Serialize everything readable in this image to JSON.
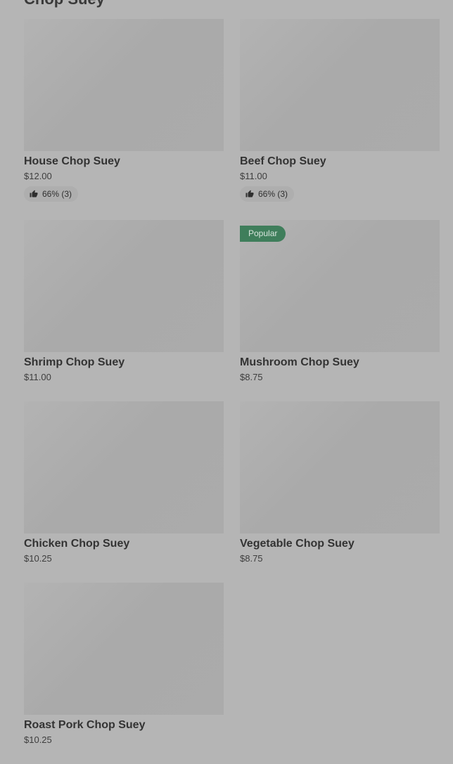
{
  "section": {
    "title": "Chop Suey"
  },
  "items": [
    {
      "name": "House Chop Suey",
      "price": "$12.00",
      "rating": "66% (3)"
    },
    {
      "name": "Beef Chop Suey",
      "price": "$11.00",
      "rating": "66% (3)"
    },
    {
      "name": "Shrimp Chop Suey",
      "price": "$11.00"
    },
    {
      "name": "Mushroom Chop Suey",
      "price": "$8.75",
      "badge": "Popular"
    },
    {
      "name": "Chicken Chop Suey",
      "price": "$10.25"
    },
    {
      "name": "Vegetable Chop Suey",
      "price": "$8.75"
    },
    {
      "name": "Roast Pork Chop Suey",
      "price": "$10.25"
    }
  ],
  "icons": {
    "rating": "thumbs-up-icon"
  },
  "colors": {
    "overlay_background": "#b5b5b5",
    "popular_badge": "#3f7e5b"
  }
}
